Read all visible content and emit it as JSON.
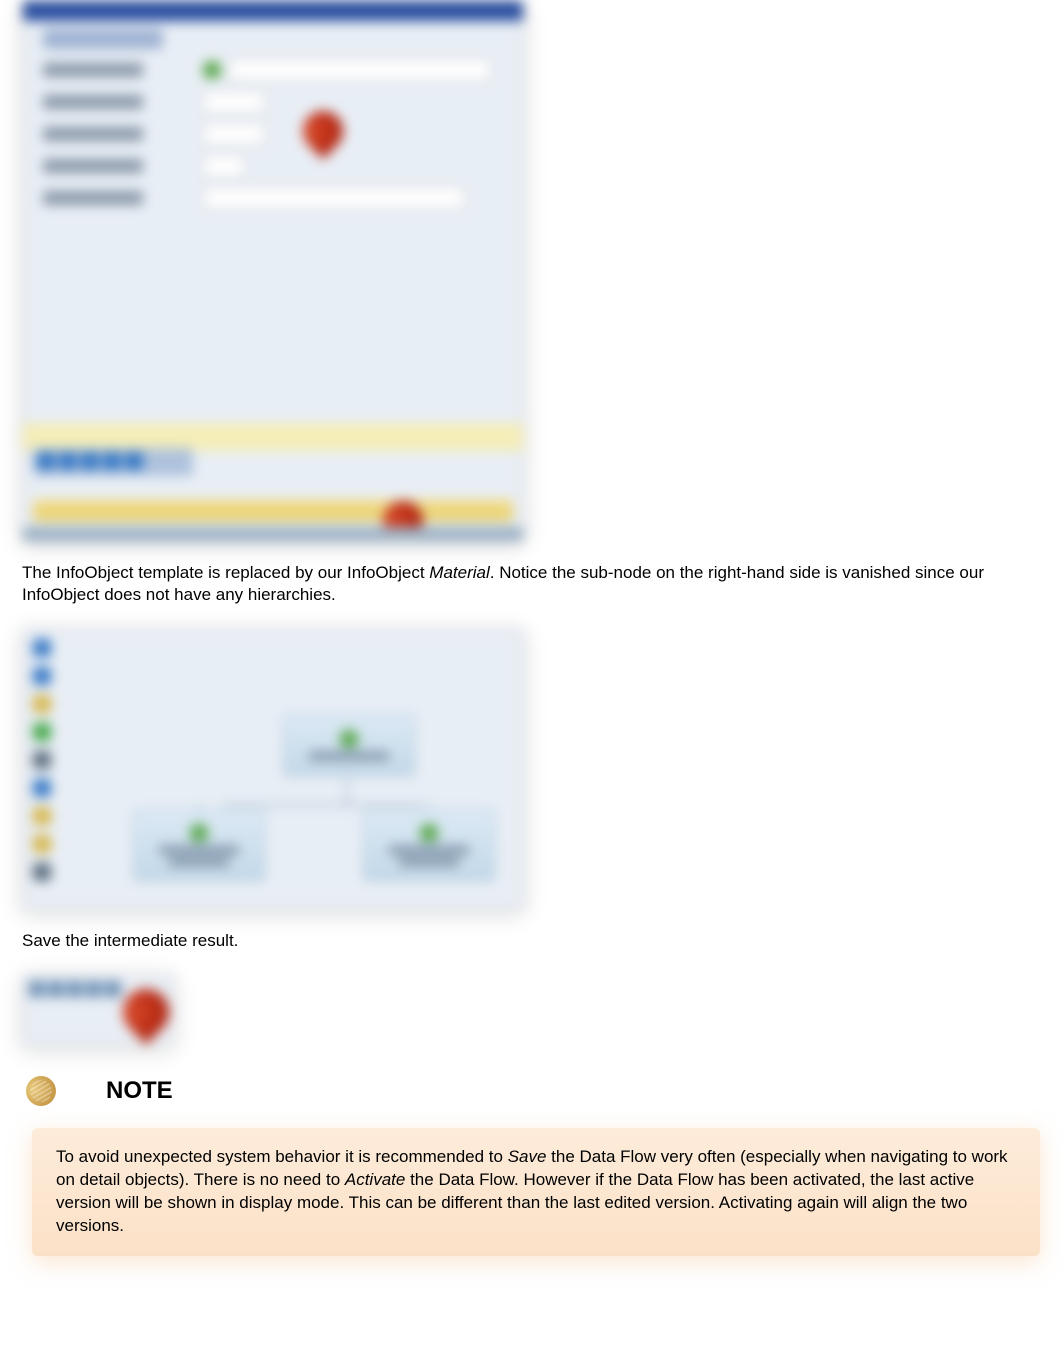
{
  "paragraph1_prefix": "The InfoObject template is replaced by our InfoObject ",
  "paragraph1_em": "Material",
  "paragraph1_suffix": ". Notice the sub-node on the right-hand side is vanished since our InfoObject does not have any hierarchies.",
  "paragraph2": "Save the intermediate result.",
  "note_label": "NOTE",
  "callout_prefix": "To avoid unexpected system behavior it is recommended to ",
  "callout_em1": "Save",
  "callout_mid1": " the Data Flow very often (especially when navigating to work on detail objects). There is no need to ",
  "callout_em2": "Activate",
  "callout_suffix": " the Data Flow. However if the Data Flow has been activated, the last active version will be shown in display mode. This can be different than the last edited version. Activating again will align the two versions."
}
